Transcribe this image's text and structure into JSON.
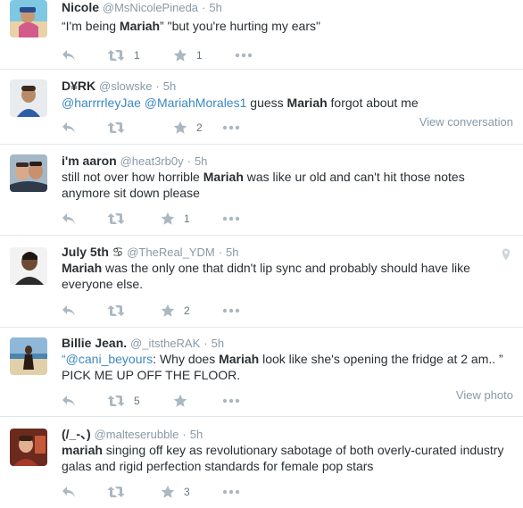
{
  "tweets": [
    {
      "name": "Nicole",
      "handle": "@MsNicolePineda",
      "time": "5h",
      "text_parts": [
        "“I'm being ",
        "Mariah",
        "” \"but you're hurting my ears\""
      ],
      "retweets": "1",
      "favorites": "1"
    },
    {
      "name": "D¥RK",
      "handle": "@slowske",
      "time": "5h",
      "mention1": "@harrrrleyJae",
      "mention2": "@MariahMorales1",
      "text_parts": [
        " guess ",
        "Mariah",
        " forgot about me"
      ],
      "retweets": "",
      "favorites": "2",
      "side_link": "View conversation"
    },
    {
      "name": "i'm aaron",
      "handle": "@heat3rb0y",
      "time": "5h",
      "text_parts": [
        "still not over how horrible ",
        "Mariah",
        " was like ur old and can't hit those notes anymore sit down please"
      ],
      "retweets": "",
      "favorites": "1"
    },
    {
      "name": "July 5th ♋",
      "handle": "@TheReal_YDM",
      "time": "5h",
      "text_parts": [
        "",
        "Mariah",
        " was the only one that didn't lip sync and probably should have like everyone else."
      ],
      "retweets": "",
      "favorites": "2"
    },
    {
      "name": "Billie Jean.",
      "handle": "@_itstheRAK",
      "time": "5h",
      "quote_open": "“",
      "mention1": "@cani_beyours",
      "text_parts": [
        ": Why does ",
        "Mariah",
        " look like she's opening the fridge at 2 am.. ” PICK ME UP OFF THE FLOOR."
      ],
      "retweets": "5",
      "favorites": "",
      "side_link": "View photo"
    },
    {
      "name": "(/_-、)",
      "handle": "@malteserubble",
      "time": "5h",
      "text_parts": [
        "",
        "mariah",
        " singing off key as revolutionary sabotage of both overly-curated industry galas and rigid perfection standards for female pop stars"
      ],
      "retweets": "",
      "favorites": "3"
    }
  ],
  "icons": {
    "reply": "reply-icon",
    "retweet": "retweet-icon",
    "favorite": "star-icon",
    "more": "more-icon",
    "geo": "location-pin-icon"
  },
  "colors": {
    "text": "#292f33",
    "meta": "#8899a6",
    "link": "#3b88c3",
    "icon": "#aab8c2",
    "divider": "#e1e8ed"
  }
}
